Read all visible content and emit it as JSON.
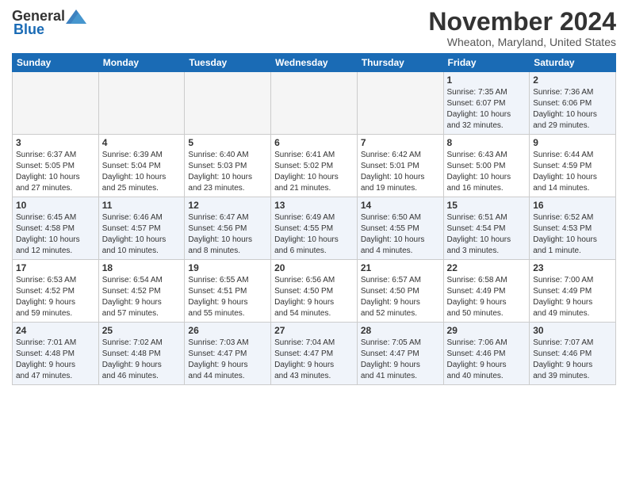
{
  "header": {
    "logo_general": "General",
    "logo_blue": "Blue",
    "month": "November 2024",
    "location": "Wheaton, Maryland, United States"
  },
  "weekdays": [
    "Sunday",
    "Monday",
    "Tuesday",
    "Wednesday",
    "Thursday",
    "Friday",
    "Saturday"
  ],
  "weeks": [
    [
      {
        "day": "",
        "info": "",
        "empty": true
      },
      {
        "day": "",
        "info": "",
        "empty": true
      },
      {
        "day": "",
        "info": "",
        "empty": true
      },
      {
        "day": "",
        "info": "",
        "empty": true
      },
      {
        "day": "",
        "info": "",
        "empty": true
      },
      {
        "day": "1",
        "info": "Sunrise: 7:35 AM\nSunset: 6:07 PM\nDaylight: 10 hours\nand 32 minutes."
      },
      {
        "day": "2",
        "info": "Sunrise: 7:36 AM\nSunset: 6:06 PM\nDaylight: 10 hours\nand 29 minutes."
      }
    ],
    [
      {
        "day": "3",
        "info": "Sunrise: 6:37 AM\nSunset: 5:05 PM\nDaylight: 10 hours\nand 27 minutes."
      },
      {
        "day": "4",
        "info": "Sunrise: 6:39 AM\nSunset: 5:04 PM\nDaylight: 10 hours\nand 25 minutes."
      },
      {
        "day": "5",
        "info": "Sunrise: 6:40 AM\nSunset: 5:03 PM\nDaylight: 10 hours\nand 23 minutes."
      },
      {
        "day": "6",
        "info": "Sunrise: 6:41 AM\nSunset: 5:02 PM\nDaylight: 10 hours\nand 21 minutes."
      },
      {
        "day": "7",
        "info": "Sunrise: 6:42 AM\nSunset: 5:01 PM\nDaylight: 10 hours\nand 19 minutes."
      },
      {
        "day": "8",
        "info": "Sunrise: 6:43 AM\nSunset: 5:00 PM\nDaylight: 10 hours\nand 16 minutes."
      },
      {
        "day": "9",
        "info": "Sunrise: 6:44 AM\nSunset: 4:59 PM\nDaylight: 10 hours\nand 14 minutes."
      }
    ],
    [
      {
        "day": "10",
        "info": "Sunrise: 6:45 AM\nSunset: 4:58 PM\nDaylight: 10 hours\nand 12 minutes."
      },
      {
        "day": "11",
        "info": "Sunrise: 6:46 AM\nSunset: 4:57 PM\nDaylight: 10 hours\nand 10 minutes."
      },
      {
        "day": "12",
        "info": "Sunrise: 6:47 AM\nSunset: 4:56 PM\nDaylight: 10 hours\nand 8 minutes."
      },
      {
        "day": "13",
        "info": "Sunrise: 6:49 AM\nSunset: 4:55 PM\nDaylight: 10 hours\nand 6 minutes."
      },
      {
        "day": "14",
        "info": "Sunrise: 6:50 AM\nSunset: 4:55 PM\nDaylight: 10 hours\nand 4 minutes."
      },
      {
        "day": "15",
        "info": "Sunrise: 6:51 AM\nSunset: 4:54 PM\nDaylight: 10 hours\nand 3 minutes."
      },
      {
        "day": "16",
        "info": "Sunrise: 6:52 AM\nSunset: 4:53 PM\nDaylight: 10 hours\nand 1 minute."
      }
    ],
    [
      {
        "day": "17",
        "info": "Sunrise: 6:53 AM\nSunset: 4:52 PM\nDaylight: 9 hours\nand 59 minutes."
      },
      {
        "day": "18",
        "info": "Sunrise: 6:54 AM\nSunset: 4:52 PM\nDaylight: 9 hours\nand 57 minutes."
      },
      {
        "day": "19",
        "info": "Sunrise: 6:55 AM\nSunset: 4:51 PM\nDaylight: 9 hours\nand 55 minutes."
      },
      {
        "day": "20",
        "info": "Sunrise: 6:56 AM\nSunset: 4:50 PM\nDaylight: 9 hours\nand 54 minutes."
      },
      {
        "day": "21",
        "info": "Sunrise: 6:57 AM\nSunset: 4:50 PM\nDaylight: 9 hours\nand 52 minutes."
      },
      {
        "day": "22",
        "info": "Sunrise: 6:58 AM\nSunset: 4:49 PM\nDaylight: 9 hours\nand 50 minutes."
      },
      {
        "day": "23",
        "info": "Sunrise: 7:00 AM\nSunset: 4:49 PM\nDaylight: 9 hours\nand 49 minutes."
      }
    ],
    [
      {
        "day": "24",
        "info": "Sunrise: 7:01 AM\nSunset: 4:48 PM\nDaylight: 9 hours\nand 47 minutes."
      },
      {
        "day": "25",
        "info": "Sunrise: 7:02 AM\nSunset: 4:48 PM\nDaylight: 9 hours\nand 46 minutes."
      },
      {
        "day": "26",
        "info": "Sunrise: 7:03 AM\nSunset: 4:47 PM\nDaylight: 9 hours\nand 44 minutes."
      },
      {
        "day": "27",
        "info": "Sunrise: 7:04 AM\nSunset: 4:47 PM\nDaylight: 9 hours\nand 43 minutes."
      },
      {
        "day": "28",
        "info": "Sunrise: 7:05 AM\nSunset: 4:47 PM\nDaylight: 9 hours\nand 41 minutes."
      },
      {
        "day": "29",
        "info": "Sunrise: 7:06 AM\nSunset: 4:46 PM\nDaylight: 9 hours\nand 40 minutes."
      },
      {
        "day": "30",
        "info": "Sunrise: 7:07 AM\nSunset: 4:46 PM\nDaylight: 9 hours\nand 39 minutes."
      }
    ]
  ]
}
